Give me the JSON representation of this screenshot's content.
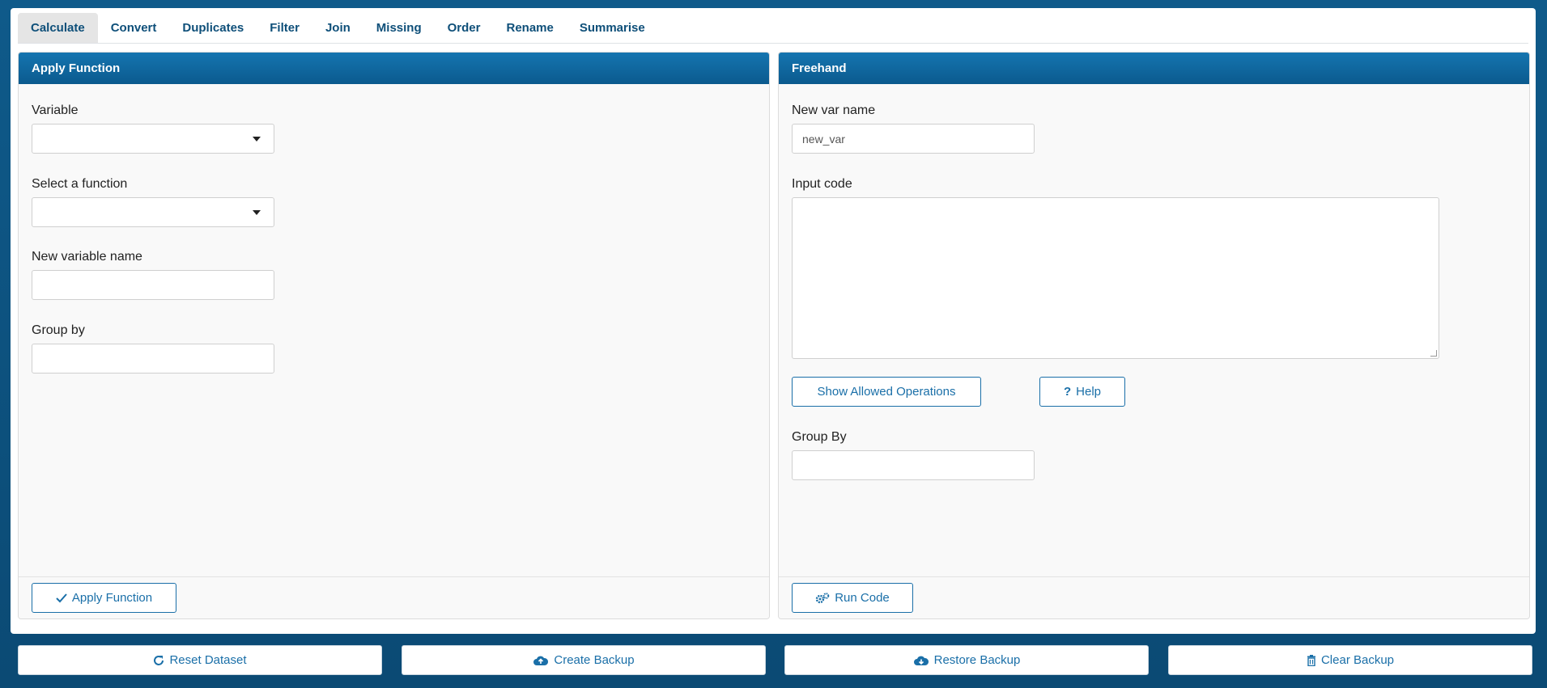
{
  "tabs": [
    {
      "label": "Calculate",
      "active": true
    },
    {
      "label": "Convert"
    },
    {
      "label": "Duplicates"
    },
    {
      "label": "Filter"
    },
    {
      "label": "Join"
    },
    {
      "label": "Missing"
    },
    {
      "label": "Order"
    },
    {
      "label": "Rename"
    },
    {
      "label": "Summarise"
    }
  ],
  "apply_function": {
    "title": "Apply Function",
    "variable_label": "Variable",
    "variable_value": "",
    "function_label": "Select a function",
    "function_value": "",
    "new_var_label": "New variable name",
    "new_var_value": "",
    "group_by_label": "Group by",
    "group_by_value": "",
    "apply_button": "Apply Function",
    "apply_icon": "check-icon"
  },
  "freehand": {
    "title": "Freehand",
    "new_var_label": "New var name",
    "new_var_value": "new_var",
    "input_code_label": "Input code",
    "input_code_value": "",
    "show_ops_button": "Show Allowed Operations",
    "help_button": "Help",
    "help_icon": "question-icon",
    "group_by_label": "Group By",
    "group_by_value": "",
    "run_button": "Run Code",
    "run_icon": "gears-icon"
  },
  "bottom_bar": {
    "reset": "Reset Dataset",
    "create": "Create Backup",
    "restore": "Restore Backup",
    "clear": "Clear Backup"
  },
  "colors": {
    "accent": "#1a6fa8",
    "header": "#0b5a8e",
    "background": "#0d4f7c"
  }
}
